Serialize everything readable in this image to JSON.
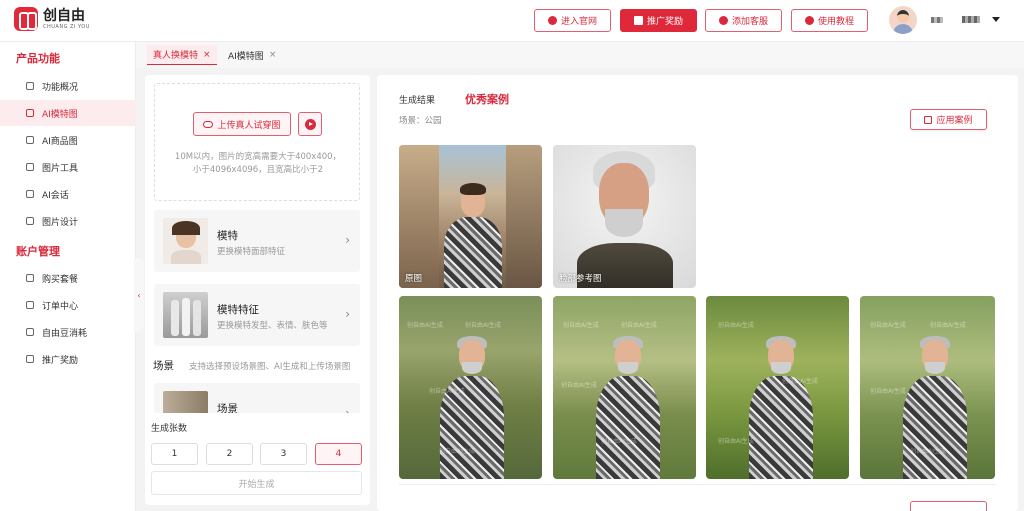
{
  "brand": {
    "name_cn": "创自由",
    "name_en": "CHUANG ZI YOU",
    "accent": "#d82a3c"
  },
  "header": {
    "buttons": [
      {
        "label": "进入官网",
        "icon": "globe-icon"
      },
      {
        "label": "推广奖励",
        "icon": "megaphone-icon"
      },
      {
        "label": "添加客服",
        "icon": "gift-icon"
      },
      {
        "label": "使用教程",
        "icon": "play-icon"
      }
    ]
  },
  "sidebar": {
    "section1": "产品功能",
    "section2": "账户管理",
    "items1": [
      {
        "label": "功能概况",
        "icon": "grid-icon"
      },
      {
        "label": "AI模特图",
        "icon": "model-icon"
      },
      {
        "label": "AI商品图",
        "icon": "image-icon"
      },
      {
        "label": "图片工具",
        "icon": "picture-icon"
      },
      {
        "label": "AI会话",
        "icon": "chat-icon"
      },
      {
        "label": "图片设计",
        "icon": "design-icon"
      }
    ],
    "items2": [
      {
        "label": "购买套餐",
        "icon": "cart-icon"
      },
      {
        "label": "订单中心",
        "icon": "order-icon"
      },
      {
        "label": "自由豆消耗",
        "icon": "coin-icon"
      },
      {
        "label": "推广奖励",
        "icon": "megaphone-icon"
      }
    ]
  },
  "tabs": [
    {
      "label": "真人换模特",
      "close": "×"
    },
    {
      "label": "AI模特图",
      "close": "×"
    }
  ],
  "left": {
    "upload_label": "上传真人试穿图",
    "hint1": "10M以内，图片的宽高需要大于400x400，",
    "hint2": "小于4096x4096，且宽高比小于2",
    "cards": [
      {
        "title": "模特",
        "sub": "更换模特面部特征"
      },
      {
        "title": "模特特征",
        "sub": "更换模特发型、表情、肤色等"
      },
      {
        "title": "场景",
        "sub": ""
      }
    ],
    "scene_label": "场景",
    "scene_hint": "支持选择预设场景图、AI生成和上传场景图",
    "count_label": "生成张数",
    "counts": [
      "1",
      "2",
      "3",
      "4"
    ],
    "generate": "开始生成"
  },
  "right": {
    "tab_result": "生成结果",
    "tab_cases": "优秀案例",
    "scene": "场景：公园",
    "apply": "应用案例",
    "caption_original": "原图",
    "caption_face": "脸部参考图",
    "watermark": "创自由AI生成"
  }
}
